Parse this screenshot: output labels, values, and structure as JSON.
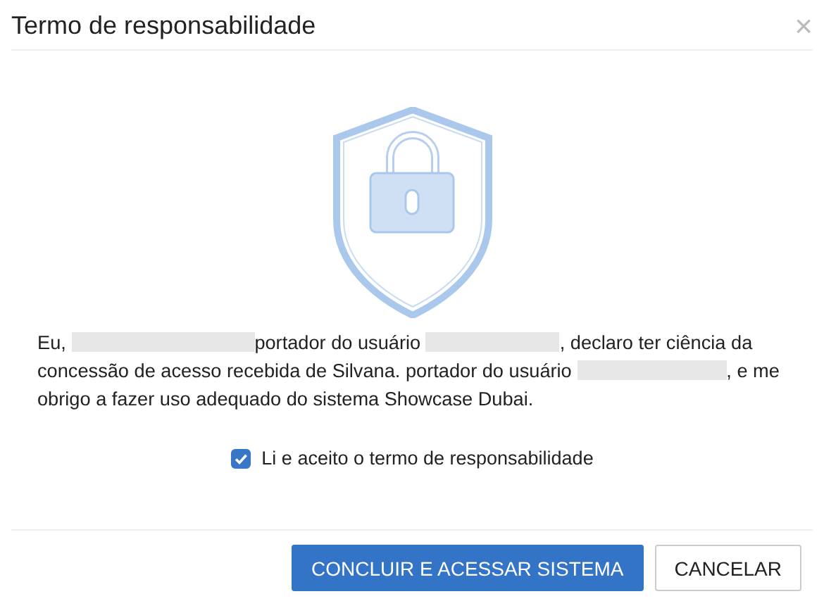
{
  "dialog": {
    "title": "Termo de responsabilidade",
    "close": "×"
  },
  "declaration": [
    {
      "kind": "text",
      "text": "Eu, "
    },
    {
      "kind": "redacted"
    },
    {
      "kind": "text",
      "text": "portador do usuário "
    },
    {
      "kind": "redacted"
    },
    {
      "kind": "text",
      "text": ", declaro ter ciência da concessão de acesso recebida de Silvana. portador do usuário "
    },
    {
      "kind": "redacted"
    },
    {
      "kind": "text",
      "text": ", e me obrigo a fazer uso adequado do sistema Showcase Dubai."
    }
  ],
  "accept": {
    "label": "Li e aceito o termo de responsabilidade",
    "checked": true
  },
  "buttons": [
    {
      "label": "CONCLUIR E ACESSAR SISTEMA",
      "kind": "primary"
    },
    {
      "label": "CANCELAR",
      "kind": "default"
    }
  ]
}
